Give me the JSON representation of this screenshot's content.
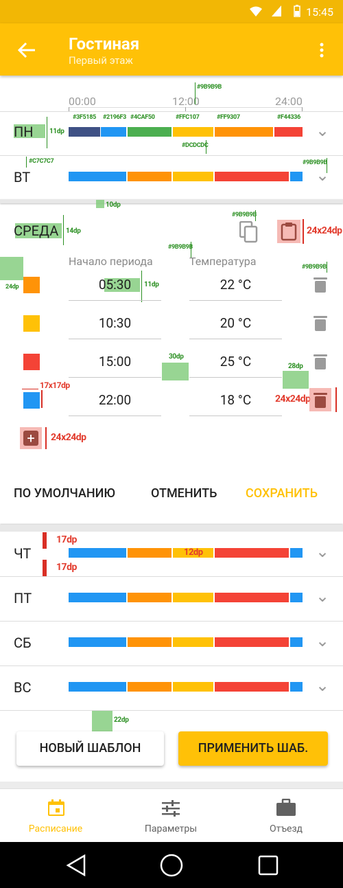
{
  "status": {
    "time": "15:45"
  },
  "app_bar": {
    "title": "Гостиная",
    "subtitle": "Первый этаж"
  },
  "timeline": {
    "tick_0": "00:00",
    "tick_12": "12:00",
    "tick_24": "24:00"
  },
  "days": {
    "mon": "ПН",
    "tue": "ВТ",
    "wed": "СРЕДА",
    "thu": "ЧТ",
    "fri": "ПТ",
    "sat": "СБ",
    "sun": "ВС"
  },
  "schedule": {
    "col_start": "Начало периода",
    "col_temp": "Температура",
    "rows": [
      {
        "time": "05:30",
        "temp": "22 °C",
        "color": "#FF9307"
      },
      {
        "time": "10:30",
        "temp": "20 °C",
        "color": "#FFC107"
      },
      {
        "time": "15:00",
        "temp": "25 °C",
        "color": "#F44336"
      },
      {
        "time": "22:00",
        "temp": "18 °C",
        "color": "#2196F3"
      }
    ]
  },
  "actions": {
    "default": "ПО УМОЛЧАНИЮ",
    "cancel": "ОТМЕНИТЬ",
    "save": "СОХРАНИТЬ"
  },
  "buttons": {
    "new_template": "НОВЫЙ ШАБЛОН",
    "apply_template": "ПРИМЕНИТЬ ШАБ."
  },
  "nav": {
    "schedule": "Расписание",
    "params": "Параметры",
    "away": "Отъезд"
  },
  "annotations": {
    "c9b9b9b": "#9B9B9B",
    "c3f5185": "#3F5185",
    "c2196f3": "#2196F3",
    "c4caf50": "#4CAF50",
    "cffc107": "#FFC107",
    "cff9307": "#FF9307",
    "cf44336": "#F44336",
    "cdcdcdc": "#DCDCDC",
    "cc7c7c7": "#C7C7C7",
    "dp11": "11dp",
    "dp10": "10dp",
    "dp14": "14dp",
    "dp24": "24dp",
    "dp30": "30dp",
    "dp28": "28dp",
    "dp22": "22dp",
    "s24": "24x24dp",
    "s17": "17x17dp",
    "h17": "17dp",
    "h12": "12dp"
  }
}
